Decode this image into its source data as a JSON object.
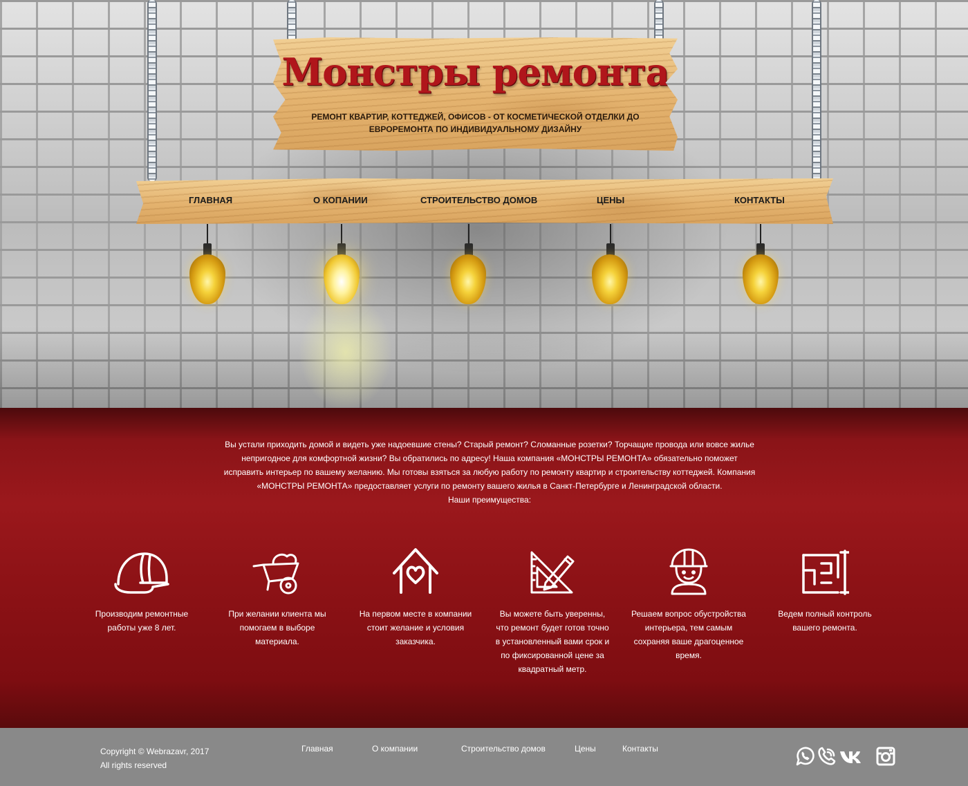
{
  "header": {
    "logo_text": "Монстры ремонта",
    "tagline": "РЕМОНТ КВАРТИР, КОТТЕДЖЕЙ, ОФИСОВ - ОТ КОСМЕТИЧЕСКОЙ ОТДЕЛКИ ДО ЕВРОРЕМОНТА ПО ИНДИВИДУАЛЬНОМУ ДИЗАЙНУ"
  },
  "nav": {
    "items": [
      {
        "label": "ГЛАВНАЯ"
      },
      {
        "label": "О КОПАНИИ"
      },
      {
        "label": "СТРОИТЕЛЬСТВО ДОМОВ"
      },
      {
        "label": "ЦЕНЫ"
      },
      {
        "label": "КОНТАКТЫ"
      }
    ]
  },
  "intro": {
    "text": "Вы устали приходить домой и видеть уже надоевшие стены? Старый ремонт? Сломанные розетки? Торчащие провода или вовсе жилье непригодное для комфортной жизни? Вы обратились по адресу! Наша компания «МОНСТРЫ РЕМОНТА» обязательно поможет исправить интерьер по вашему желанию. Мы готовы взяться за любую работу по ремонту квартир и строительству коттеджей. Компания «МОНСТРЫ РЕМОНТА» предоставляет услуги по ремонту вашего жилья в Санкт-Петербурге и Ленинградской области.",
    "advantages_heading": "Наши преимущества:"
  },
  "advantages": [
    {
      "icon": "hard-hat-icon",
      "text": "Производим ремонтные работы уже 8 лет."
    },
    {
      "icon": "wheelbarrow-icon",
      "text": "При желании клиента мы помогаем в выборе материала."
    },
    {
      "icon": "house-heart-icon",
      "text": "На первом месте в компании стоит желание и условия заказчика."
    },
    {
      "icon": "pencil-ruler-icon",
      "text": "Вы можете быть уверенны, что ремонт будет готов точно в установленный вами срок и по фиксированной цене за квадратный метр."
    },
    {
      "icon": "builder-icon",
      "text": "Решаем вопрос обустройства интерьера, тем самым сохраняя ваше драгоценное время."
    },
    {
      "icon": "floor-plan-icon",
      "text": "Ведем полный контроль вашего ремонта."
    }
  ],
  "footer": {
    "copyright": "Copyright © Webrazavr, 2017",
    "rights": "All rights reserved",
    "links": [
      {
        "label": "Главная"
      },
      {
        "label": "О компании"
      },
      {
        "label": "Строительство домов"
      },
      {
        "label": "Цены"
      },
      {
        "label": "Контакты"
      }
    ],
    "social": [
      "whatsapp-icon",
      "viber-icon",
      "vk-icon",
      "instagram-icon"
    ]
  },
  "colors": {
    "brand_red": "#9b181c",
    "logo_red": "#b0161b",
    "wood": "#e4b36f",
    "footer_gray": "#898989"
  }
}
